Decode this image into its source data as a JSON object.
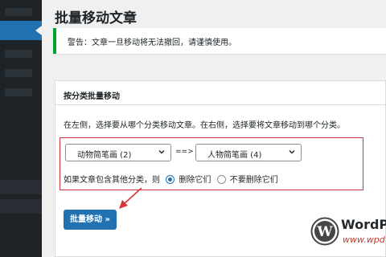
{
  "page": {
    "title": "批量移动文章"
  },
  "notice": {
    "text": "警告：文章一旦移动将无法撤回，请谨慎使用。"
  },
  "panel": {
    "title": "按分类批量移动",
    "description": "在左侧，选择要从哪个分类移动文章。在右侧，选择要将文章移动到哪个分类。",
    "from_select": {
      "selected": "动物简笔画 (2)"
    },
    "separator": "==>",
    "to_select": {
      "selected": "人物简笔画 (4)"
    },
    "option_prompt": "如果文章包含其他分类，则",
    "option_delete": "删除它们",
    "option_keep": "不要删除它们",
    "option_selected": "删除它们",
    "submit_label": "批量移动 »"
  },
  "watermark": {
    "name": "WordPr",
    "url": "www.wpd"
  },
  "colors": {
    "sidebar": "#1d2327",
    "accent": "#2271b1",
    "notice_border": "#00a32a",
    "highlight": "#d63638"
  }
}
